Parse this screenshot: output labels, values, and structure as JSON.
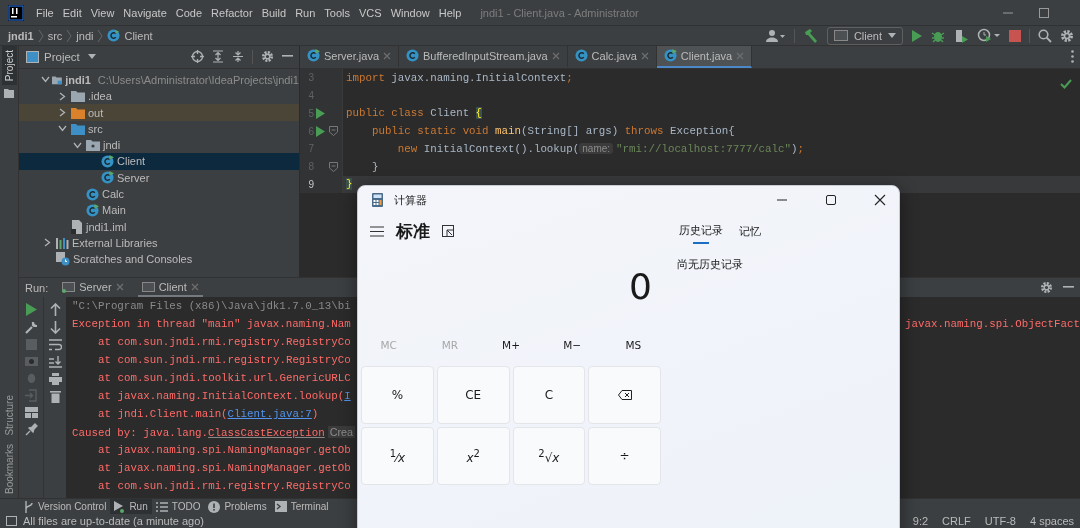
{
  "ide": {
    "menu": [
      "File",
      "Edit",
      "View",
      "Navigate",
      "Code",
      "Refactor",
      "Build",
      "Run",
      "Tools",
      "VCS",
      "Window",
      "Help"
    ],
    "title": "jndi1 - Client.java - Administrator",
    "breadcrumbs": [
      "jndi1",
      "src",
      "jndi",
      "Client"
    ],
    "run_config": "Client",
    "side_tabs": {
      "top": [
        {
          "label": "Project",
          "selected": true
        }
      ],
      "bottom": [
        {
          "label": "Structure",
          "selected": false
        },
        {
          "label": "Bookmarks",
          "selected": false
        }
      ]
    },
    "project_panel": {
      "title": "Project",
      "tree": [
        {
          "label": "jndi1",
          "kind": "module",
          "path": "C:\\Users\\Administrator\\IdeaProjects\\jndi1",
          "expanded": true,
          "selected": false,
          "children": [
            {
              "label": ".idea",
              "kind": "folder",
              "expanded": false,
              "selected": false
            },
            {
              "label": "out",
              "kind": "excluded",
              "expanded": false,
              "selected": false
            },
            {
              "label": "src",
              "kind": "source",
              "expanded": true,
              "selected": false,
              "children": [
                {
                  "label": "jndi",
                  "kind": "package",
                  "expanded": true,
                  "selected": false,
                  "children": [
                    {
                      "label": "Client",
                      "kind": "runnable-class",
                      "selected": true
                    },
                    {
                      "label": "Server",
                      "kind": "runnable-class",
                      "selected": false
                    }
                  ]
                },
                {
                  "label": "Calc",
                  "kind": "class",
                  "selected": false
                },
                {
                  "label": "Main",
                  "kind": "runnable-class",
                  "selected": false
                }
              ]
            },
            {
              "label": "jndi1.iml",
              "kind": "file",
              "selected": false
            }
          ]
        },
        {
          "label": "External Libraries",
          "kind": "libraries",
          "expanded": false,
          "selected": false
        },
        {
          "label": "Scratches and Consoles",
          "kind": "scratches",
          "selected": false
        }
      ]
    },
    "editor": {
      "tabs": [
        {
          "label": "Server.java",
          "kind": "runnable-class",
          "selected": false
        },
        {
          "label": "BufferedInputStream.java",
          "kind": "class",
          "selected": false
        },
        {
          "label": "Calc.java",
          "kind": "class",
          "selected": false
        },
        {
          "label": "Client.java",
          "kind": "runnable-class",
          "selected": true
        }
      ],
      "lines": [
        {
          "number": "3",
          "run": false,
          "fold": false,
          "current": false,
          "tokens": [
            {
              "text": "import ",
              "kind": "keyword"
            },
            {
              "text": "javax.naming.InitialContext",
              "kind": "plain"
            },
            {
              "text": ";",
              "kind": "keyword"
            }
          ]
        },
        {
          "number": "4",
          "run": false,
          "fold": false,
          "current": false
        },
        {
          "number": "5",
          "run": true,
          "fold": false,
          "current": false,
          "tokens": [
            {
              "text": "public class ",
              "kind": "keyword"
            },
            {
              "text": "Client ",
              "kind": "plain"
            },
            {
              "text": "{",
              "kind": "brace"
            }
          ]
        },
        {
          "number": "6",
          "run": true,
          "fold": true,
          "current": false,
          "tokens": [
            {
              "text": "    public static void ",
              "kind": "keyword"
            },
            {
              "text": "main",
              "kind": "method"
            },
            {
              "text": "(String[] args) ",
              "kind": "plain"
            },
            {
              "text": "throws ",
              "kind": "keyword"
            },
            {
              "text": "Exception{",
              "kind": "plain"
            }
          ]
        },
        {
          "number": "7",
          "run": false,
          "fold": false,
          "current": false,
          "tokens": [
            {
              "text": "        new ",
              "kind": "keyword"
            },
            {
              "text": "InitialContext().lookup(",
              "kind": "plain"
            },
            {
              "text": "name:",
              "kind": "hint"
            },
            {
              "text": "\"rmi://localhost:7777/calc\"",
              "kind": "string"
            },
            {
              "text": ")",
              "kind": "plain"
            },
            {
              "text": ";",
              "kind": "keyword"
            }
          ]
        },
        {
          "number": "8",
          "run": false,
          "fold": true,
          "current": false,
          "tokens": [
            {
              "text": "    }",
              "kind": "plain"
            }
          ]
        },
        {
          "number": "9",
          "run": false,
          "fold": false,
          "current": true,
          "tokens": [
            {
              "text": "}",
              "kind": "brace"
            }
          ]
        }
      ]
    },
    "run_panel": {
      "label": "Run:",
      "tabs": [
        {
          "label": "Server",
          "selected": false
        },
        {
          "label": "Client",
          "selected": true
        }
      ],
      "lines": [
        {
          "kind": "command",
          "segments": [
            {
              "text": "\"C:\\Program Files (x86)\\Java\\jdk1.7.0_13\\bi",
              "kind": "text"
            }
          ]
        },
        {
          "kind": "exception",
          "segments": [
            {
              "text": "Exception in thread \"main\" javax.naming.Nam",
              "kind": "text"
            }
          ],
          "right": "javax.naming.spi.ObjectFact"
        },
        {
          "kind": "frame",
          "segments": [
            {
              "text": "at com.sun.jndi.rmi.registry.RegistryCo",
              "kind": "text"
            }
          ]
        },
        {
          "kind": "frame",
          "segments": [
            {
              "text": "at com.sun.jndi.rmi.registry.RegistryCo",
              "kind": "text"
            }
          ]
        },
        {
          "kind": "frame",
          "segments": [
            {
              "text": "at com.sun.jndi.toolkit.url.GenericURLC",
              "kind": "text"
            }
          ]
        },
        {
          "kind": "frame",
          "segments": [
            {
              "text": "at javax.naming.InitialContext.lookup(",
              "kind": "text"
            },
            {
              "text": "I",
              "kind": "link"
            }
          ]
        },
        {
          "kind": "frame",
          "segments": [
            {
              "text": "at jndi.Client.main(",
              "kind": "text"
            },
            {
              "text": "Client.java:7",
              "kind": "link"
            },
            {
              "text": ")",
              "kind": "text"
            }
          ]
        },
        {
          "kind": "exception",
          "segments": [
            {
              "text": "Caused by: java.lang.",
              "kind": "text"
            },
            {
              "text": "ClassCastException",
              "kind": "class-link"
            },
            {
              "text": "Crea",
              "kind": "hint"
            }
          ]
        },
        {
          "kind": "frame",
          "segments": [
            {
              "text": "at javax.naming.spi.NamingManager.getOb",
              "kind": "text"
            }
          ]
        },
        {
          "kind": "frame",
          "segments": [
            {
              "text": "at javax.naming.spi.NamingManager.getOb",
              "kind": "text"
            }
          ]
        },
        {
          "kind": "frame",
          "segments": [
            {
              "text": "at com.sun.jndi.rmi.registry.RegistryCo",
              "kind": "text"
            }
          ]
        }
      ]
    },
    "tool_windows": [
      {
        "label": "Version Control",
        "kind": "vcs",
        "selected": false
      },
      {
        "label": "Run",
        "kind": "run",
        "selected": true
      },
      {
        "label": "TODO",
        "kind": "todo",
        "selected": false
      },
      {
        "label": "Problems",
        "kind": "problems",
        "selected": false
      },
      {
        "label": "Terminal",
        "kind": "terminal",
        "selected": false
      }
    ],
    "status": {
      "message": "All files are up-to-date (a minute ago)",
      "items": [
        "9:2",
        "CRLF",
        "UTF-8",
        "4 spaces"
      ]
    }
  },
  "calculator": {
    "title": "计算器",
    "mode": "标准",
    "display": "0",
    "tabs": [
      {
        "label": "历史记录",
        "selected": true
      },
      {
        "label": "记忆",
        "selected": false
      }
    ],
    "empty_message": "尚无历史记录",
    "memory": [
      {
        "label": "MC",
        "disabled": true
      },
      {
        "label": "MR",
        "disabled": true
      },
      {
        "label": "M+",
        "disabled": false
      },
      {
        "label": "M−",
        "disabled": false
      },
      {
        "label": "MS",
        "disabled": false
      }
    ],
    "keys": [
      {
        "kind": "text",
        "label": "%"
      },
      {
        "kind": "text",
        "label": "CE"
      },
      {
        "kind": "text",
        "label": "C"
      },
      {
        "kind": "backspace"
      },
      {
        "kind": "text",
        "label": "$^{1}$⁄*x*"
      },
      {
        "kind": "text",
        "label": "*x*$^{2}$"
      },
      {
        "kind": "text",
        "label": "$^{2}$√*x*"
      },
      {
        "kind": "text",
        "label": "÷"
      }
    ]
  }
}
